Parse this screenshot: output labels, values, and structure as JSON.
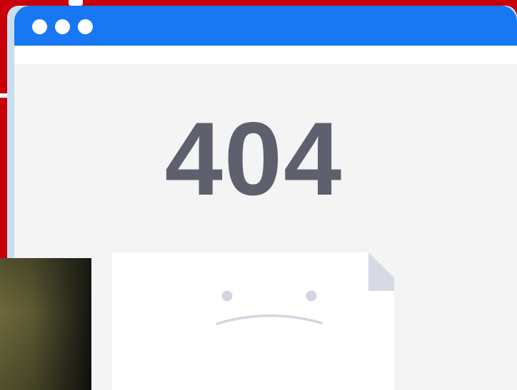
{
  "page": {
    "error_code": "404"
  },
  "window": {
    "controls": [
      "window-dot",
      "window-dot",
      "window-dot"
    ]
  },
  "illustration": {
    "icon": "sad-document-icon",
    "mood": "sad"
  },
  "colors": {
    "backdrop": "#c8000a",
    "title_bar": "#1877f2",
    "page_background": "#f4f4f5",
    "error_text": "#5e606e",
    "document": "#ffffff",
    "document_fold": "#d7d9e4",
    "face": "#d3d5e0"
  }
}
